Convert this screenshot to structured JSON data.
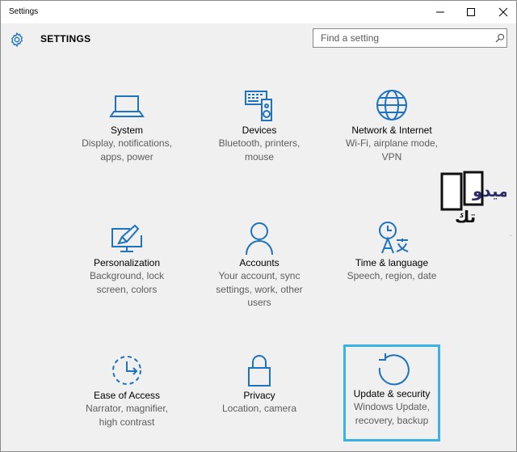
{
  "window": {
    "title": "Settings"
  },
  "header": {
    "title": "SETTINGS",
    "search_placeholder": "Find a setting",
    "search_value": ""
  },
  "tiles": [
    {
      "label": "System",
      "desc1": "Display, notifications,",
      "desc2": "apps, power",
      "desc3": "",
      "icon": "laptop-icon"
    },
    {
      "label": "Devices",
      "desc1": "Bluetooth, printers,",
      "desc2": "mouse",
      "desc3": "",
      "icon": "keyboard-speaker-icon"
    },
    {
      "label": "Network & Internet",
      "desc1": "Wi-Fi, airplane mode,",
      "desc2": "VPN",
      "desc3": "",
      "icon": "globe-icon"
    },
    {
      "label": "Personalization",
      "desc1": "Background, lock",
      "desc2": "screen, colors",
      "desc3": "",
      "icon": "paint-monitor-icon"
    },
    {
      "label": "Accounts",
      "desc1": "Your account, sync",
      "desc2": "settings, work, other",
      "desc3": "users",
      "icon": "person-icon"
    },
    {
      "label": "Time & language",
      "desc1": "Speech, region, date",
      "desc2": "",
      "desc3": "",
      "icon": "time-language-icon"
    },
    {
      "label": "Ease of Access",
      "desc1": "Narrator, magnifier,",
      "desc2": "high contrast",
      "desc3": "",
      "icon": "ease-of-access-icon"
    },
    {
      "label": "Privacy",
      "desc1": "Location, camera",
      "desc2": "",
      "desc3": "",
      "icon": "lock-icon"
    },
    {
      "label": "Update & security",
      "desc1": "Windows Update,",
      "desc2": "recovery, backup",
      "desc3": "",
      "icon": "refresh-icon"
    }
  ],
  "colors": {
    "accent": "#1e73be",
    "selection": "#3bb2e3",
    "background": "#f0f0f0"
  },
  "watermark": {
    "line1": "ميدو",
    "line2": "تك"
  }
}
